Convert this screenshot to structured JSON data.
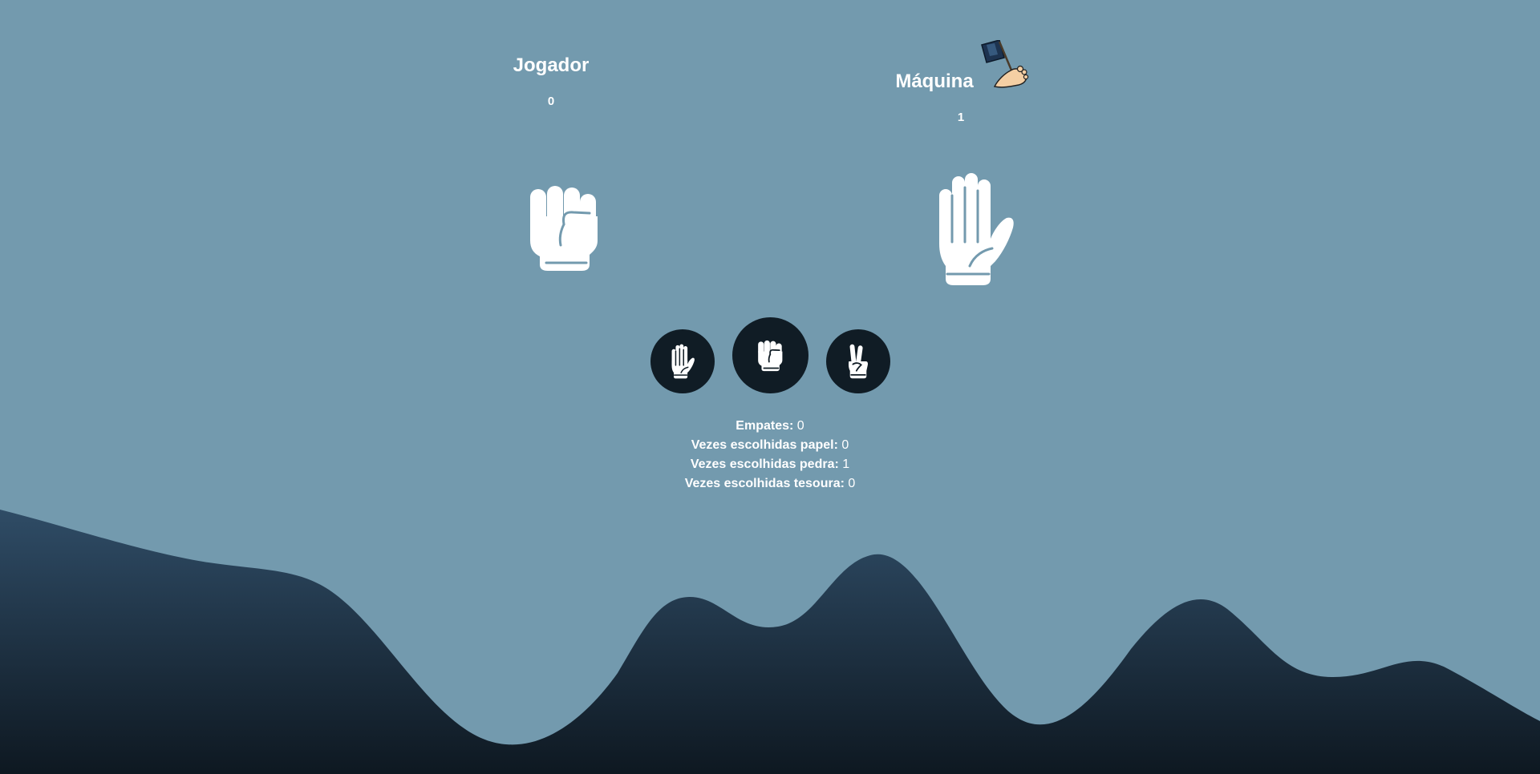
{
  "player": {
    "name": "Jogador",
    "score": "0",
    "hand": "rock"
  },
  "machine": {
    "name": "Máquina",
    "score": "1",
    "hand": "paper",
    "winner_icon": "flag-foot-icon"
  },
  "choices": [
    {
      "id": "paper",
      "icon": "paper-hand-icon"
    },
    {
      "id": "rock",
      "icon": "rock-fist-icon",
      "selected": true
    },
    {
      "id": "scissors",
      "icon": "scissors-hand-icon"
    }
  ],
  "stats": {
    "ties_label": "Empates:",
    "ties_value": "0",
    "paper_label": "Vezes escolhidas papel:",
    "paper_value": "0",
    "rock_label": "Vezes escolhidas pedra:",
    "rock_value": "1",
    "scissors_label": "Vezes escolhidas tesoura:",
    "scissors_value": "0"
  },
  "colors": {
    "background": "#739aae",
    "wave_top": "#2d4a63",
    "wave_bottom": "#0f1a23",
    "button": "#101c25",
    "text": "#ffffff"
  }
}
